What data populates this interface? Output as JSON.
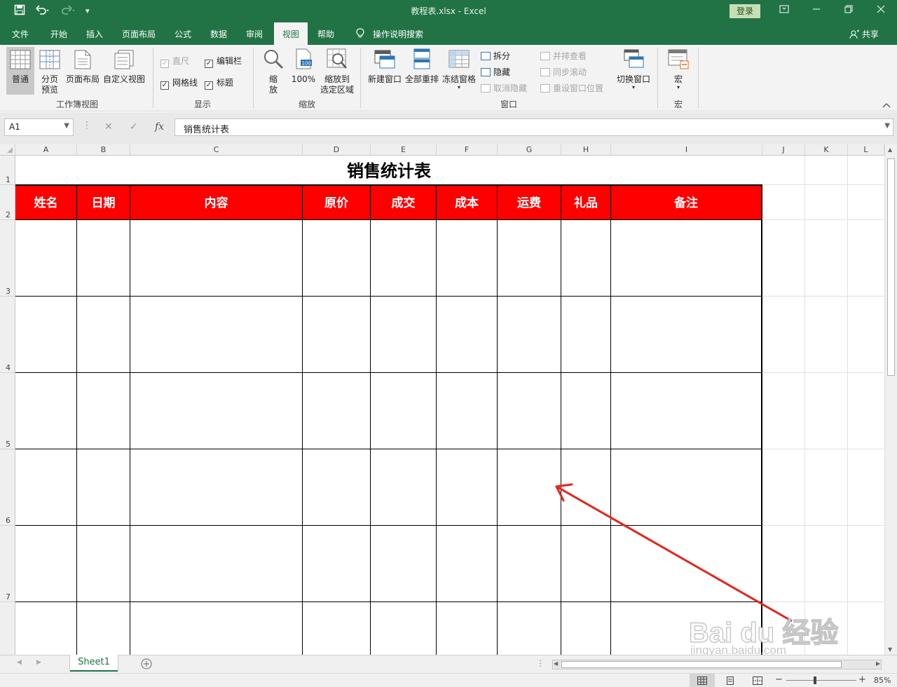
{
  "window": {
    "title": "教程表.xlsx  -  Excel",
    "login_label": "登录",
    "qat_more": "▾"
  },
  "tabs": [
    {
      "label": "文件"
    },
    {
      "label": "开始"
    },
    {
      "label": "插入"
    },
    {
      "label": "页面布局"
    },
    {
      "label": "公式"
    },
    {
      "label": "数据"
    },
    {
      "label": "审阅"
    },
    {
      "label": "视图"
    },
    {
      "label": "帮助"
    },
    {
      "label": "操作说明搜索"
    }
  ],
  "share_label": "共享",
  "ribbon": {
    "workbook_views": {
      "normal": "普通",
      "page_break_1": "分页",
      "page_break_2": "预览",
      "page_layout": "页面布局",
      "custom_views": "自定义视图",
      "group": "工作簿视图"
    },
    "show": {
      "ruler": "直尺",
      "formula_bar": "编辑栏",
      "gridlines": "网格线",
      "headings": "标题",
      "group": "显示"
    },
    "zoom": {
      "zoom_1": "缩",
      "zoom_2": "放",
      "hundred": "100%",
      "zoom_sel_1": "缩放到",
      "zoom_sel_2": "选定区域",
      "group": "缩放"
    },
    "window": {
      "new_window": "新建窗口",
      "arrange_all": "全部重排",
      "freeze": "冻结窗格",
      "split": "拆分",
      "hide": "隐藏",
      "unhide": "取消隐藏",
      "side_by_side": "并排查看",
      "sync_scroll": "同步滚动",
      "reset_pos": "重设窗口位置",
      "switch": "切换窗口",
      "group": "窗口"
    },
    "macros": {
      "macro": "宏",
      "group": "宏"
    }
  },
  "formula_bar": {
    "name_box": "A1",
    "content": "销售统计表"
  },
  "columns": [
    "A",
    "B",
    "C",
    "D",
    "E",
    "F",
    "G",
    "H",
    "I",
    "J",
    "K",
    "L"
  ],
  "rows": [
    "1",
    "2",
    "3",
    "4",
    "5",
    "6",
    "7"
  ],
  "sheet": {
    "title": "销售统计表",
    "headers": [
      "姓名",
      "日期",
      "内容",
      "原价",
      "成交",
      "成本",
      "运费",
      "礼品",
      "备注"
    ]
  },
  "sheet_tab": "Sheet1",
  "status": {
    "zoom": "85%",
    "minus": "−",
    "plus": "+"
  },
  "watermark": {
    "main": "Bai du 经验",
    "sub": "jingyan.baidu.com"
  },
  "colors": {
    "excel_green": "#217346",
    "header_fill": "#ff0000",
    "arrow": "#e8221c"
  }
}
